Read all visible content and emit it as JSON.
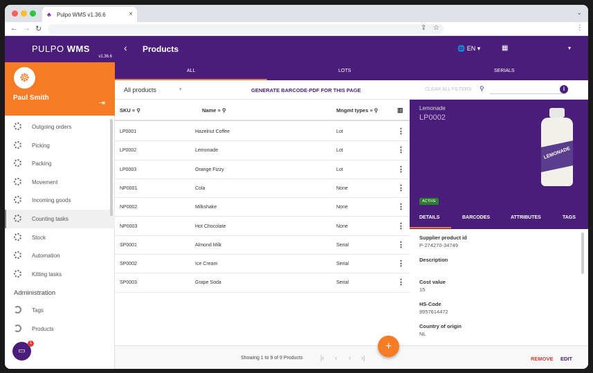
{
  "browser": {
    "tab_title": "Pulpo WMS v1.36.6",
    "tab_close": "×",
    "expand_icon": "⌄",
    "nav": {
      "back": "←",
      "forward": "→",
      "reload": "↻"
    }
  },
  "sidebar": {
    "brand_light": "PULPO ",
    "brand_bold": "WMS",
    "version": "v1.36.6",
    "user_name": "Paul Smith",
    "menu": [
      {
        "label": "Outgoing orders"
      },
      {
        "label": "Picking"
      },
      {
        "label": "Packing"
      },
      {
        "label": "Movement"
      },
      {
        "label": "Incoming goods"
      },
      {
        "label": "Counting tasks"
      },
      {
        "label": "Stock"
      },
      {
        "label": "Automation"
      },
      {
        "label": "Kitting tasks"
      }
    ],
    "admin_section": "Administration",
    "admin_menu": [
      {
        "label": "Tags"
      },
      {
        "label": "Products"
      }
    ],
    "chat_badge": "1"
  },
  "header": {
    "title": "Products",
    "language": "EN",
    "tabs": {
      "all": "ALL",
      "lots": "LOTS",
      "serials": "SERIALS"
    }
  },
  "filter": {
    "select_value": "All products",
    "generate_label": "GENERATE BARCODE-PDF FOR THIS PAGE",
    "clear_label": "CLEAR ALL FILTERS"
  },
  "table": {
    "headers": {
      "sku": "SKU",
      "name": "Name",
      "mgmt": "Mngmt types"
    },
    "rows": [
      {
        "sku": "LP0001",
        "name": "Hazelnut Coffee",
        "mgmt": "Lot"
      },
      {
        "sku": "LP0002",
        "name": "Lemonade",
        "mgmt": "Lot"
      },
      {
        "sku": "LP0003",
        "name": "Orange Fizzy",
        "mgmt": "Lot"
      },
      {
        "sku": "NP0001",
        "name": "Cola",
        "mgmt": "None"
      },
      {
        "sku": "NP0002",
        "name": "Milkshake",
        "mgmt": "None"
      },
      {
        "sku": "NP0003",
        "name": "Hot Chocolate",
        "mgmt": "None"
      },
      {
        "sku": "SP0001",
        "name": "Almond Milk",
        "mgmt": "Serial"
      },
      {
        "sku": "SP0002",
        "name": "Ice Cream",
        "mgmt": "Serial"
      },
      {
        "sku": "SP0003",
        "name": "Grape Soda",
        "mgmt": "Serial"
      }
    ]
  },
  "detail": {
    "name": "Lemonade",
    "sku": "LP0002",
    "bottle_label": "LEMONADE",
    "status": "ACTIVE",
    "tabs": {
      "details": "DETAILS",
      "barcodes": "BARCODES",
      "attributes": "ATTRIBUTES",
      "tags": "TAGS"
    },
    "fields": {
      "supplier_label": "Supplier product id",
      "supplier_value": "P-274270-34749",
      "description_label": "Description",
      "cost_label": "Cost value",
      "cost_value": "15",
      "hs_label": "HS-Code",
      "hs_value": "9957614472",
      "country_label": "Country of origin",
      "country_value": "NL"
    }
  },
  "footer": {
    "showing": "Showing 1 to 9 of 9 Products",
    "remove": "REMOVE",
    "edit": "EDIT"
  },
  "colors": {
    "brand_purple": "#4a1d7a",
    "accent_orange": "#f57c24",
    "active_green": "#2e7d32",
    "remove_red": "#e53935"
  }
}
